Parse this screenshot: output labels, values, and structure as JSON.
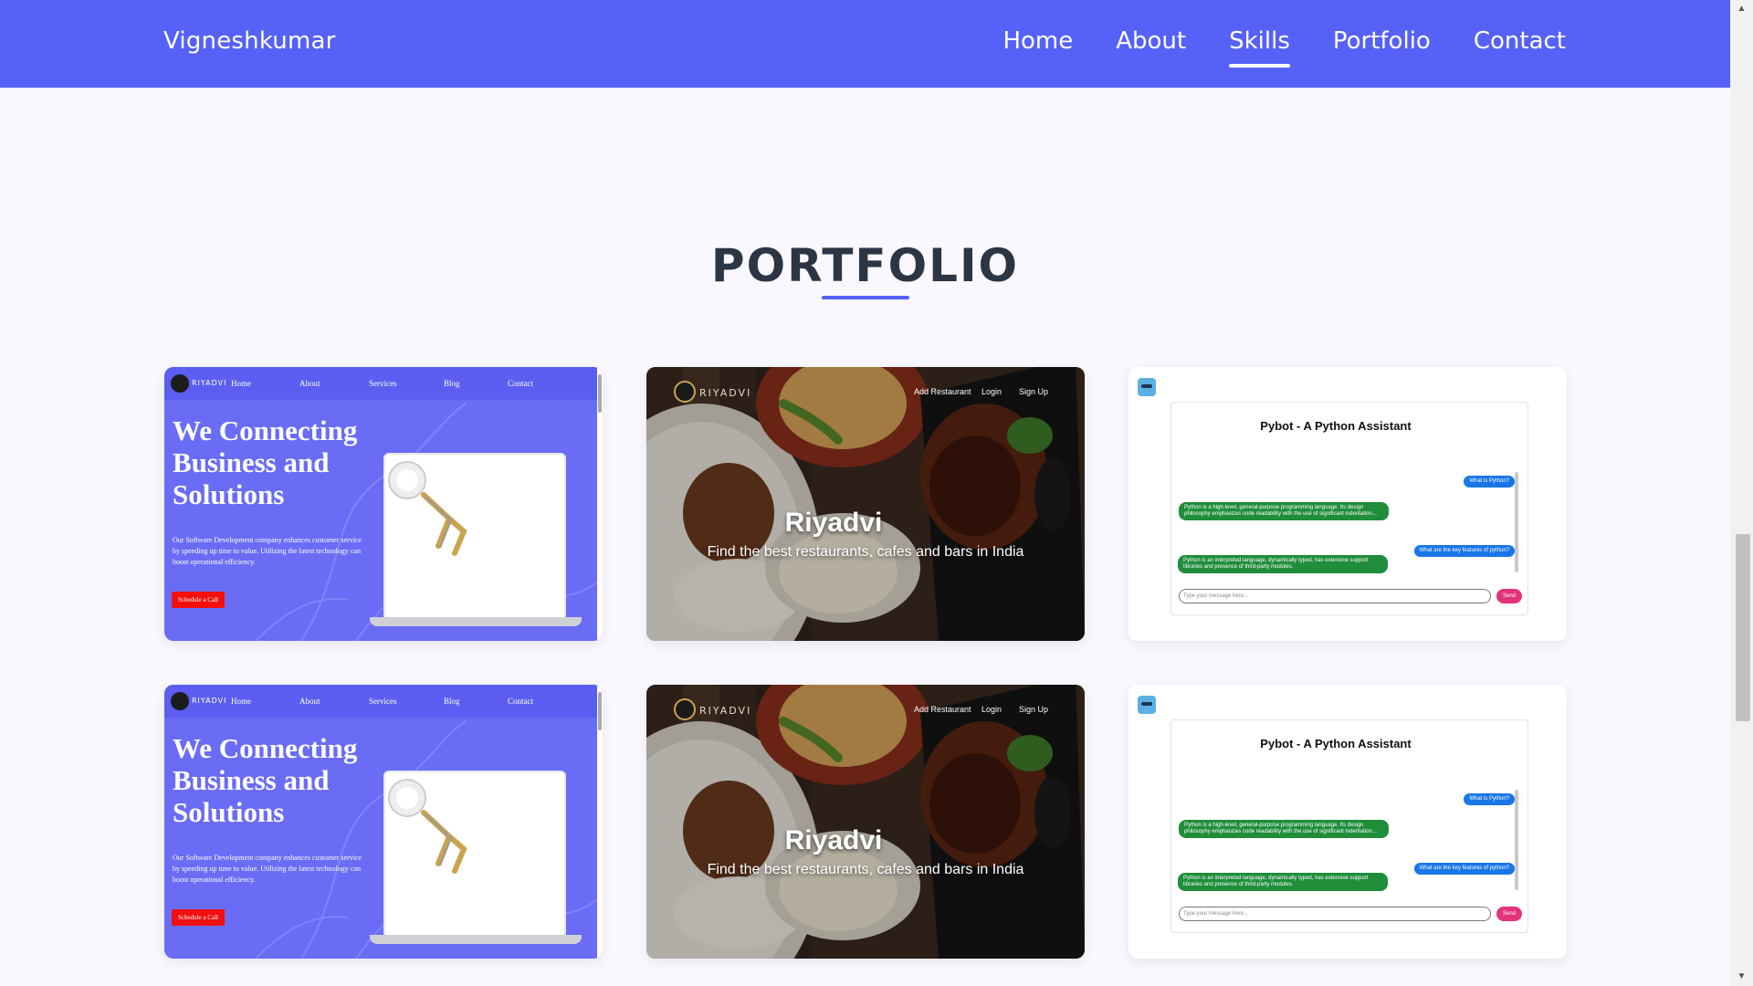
{
  "nav": {
    "brand": "Vigneshkumar",
    "links": [
      "Home",
      "About",
      "Skills",
      "Portfolio",
      "Contact"
    ],
    "active": "Skills"
  },
  "section": {
    "title": "PORTFOLIO"
  },
  "colors": {
    "primary": "#5661f8",
    "heading": "#2b3544",
    "cta_red": "#f20f0f",
    "send_pink": "#e3337a"
  },
  "projects": {
    "business": {
      "logo": "RIYADVI",
      "nav": [
        "Home",
        "About",
        "Services",
        "Blog",
        "Contact"
      ],
      "hero": "We Connecting Business and Solutions",
      "description": "Our Software Development company enhances customer service by speeding up time to value. Utilizing the latest technology can boost operational efficiency.",
      "cta": "Schedule a Call"
    },
    "restaurant": {
      "logo": "RIYADVI",
      "nav": [
        "Add Restaurant",
        "Login",
        "Sign Up"
      ],
      "title": "Riyadvi",
      "subtitle": "Find the best restaurants, cafes and bars in India"
    },
    "chatbot": {
      "title": "Pybot - A Python Assistant",
      "q1": "What is Python?",
      "a1": "Python is a high-level, general-purpose programming language. Its design philosophy emphasizes code readability with the use of significant indentation...",
      "q2": "What are the key features of python?",
      "a2": "Python is an interpreted language, dynamically typed, has extensive support libraries and presence of third-party modules.",
      "placeholder": "Type your message here...",
      "send": "Send"
    }
  }
}
